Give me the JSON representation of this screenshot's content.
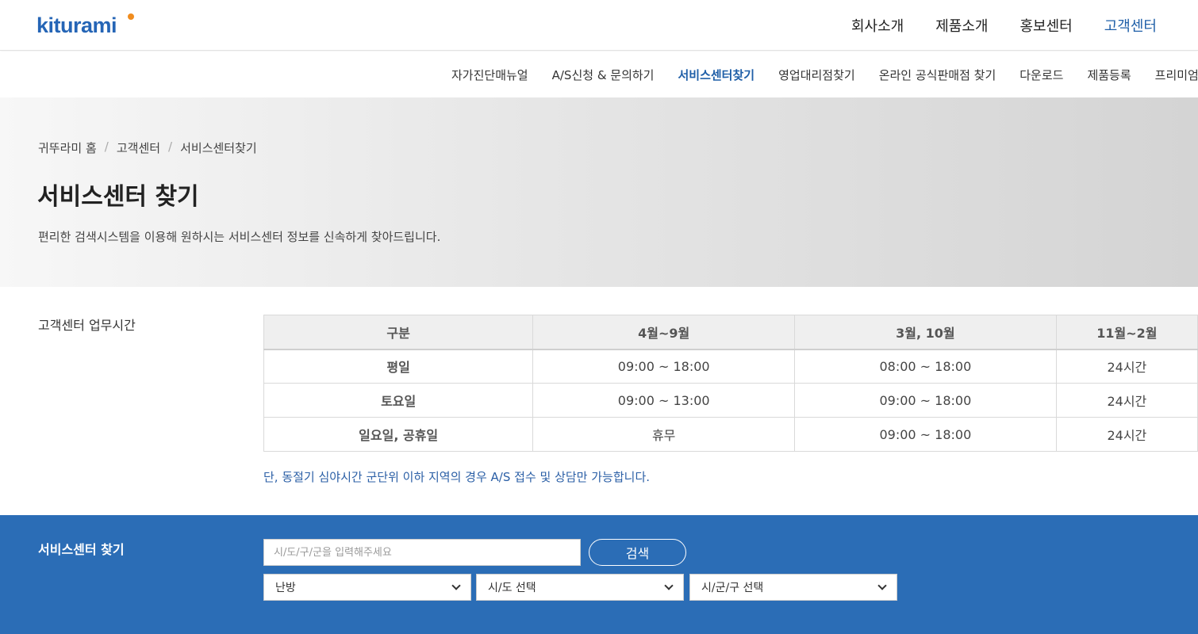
{
  "brand": {
    "logo_text": "kiturami"
  },
  "gnb": [
    {
      "label": "회사소개",
      "active": false
    },
    {
      "label": "제품소개",
      "active": false
    },
    {
      "label": "홍보센터",
      "active": false
    },
    {
      "label": "고객센터",
      "active": true
    }
  ],
  "snb": [
    {
      "label": "자가진단매뉴얼",
      "active": false
    },
    {
      "label": "A/S신청 & 문의하기",
      "active": false
    },
    {
      "label": "서비스센터찾기",
      "active": true
    },
    {
      "label": "영업대리점찾기",
      "active": false
    },
    {
      "label": "온라인 공식판매점 찾기",
      "active": false
    },
    {
      "label": "다운로드",
      "active": false
    },
    {
      "label": "제품등록",
      "active": false
    },
    {
      "label": "프리미엄",
      "active": false
    }
  ],
  "breadcrumb": [
    "귀뚜라미 홈",
    "고객센터",
    "서비스센터찾기"
  ],
  "hero": {
    "title": "서비스센터 찾기",
    "description": "편리한 검색시스템을 이용해 원하시는 서비스센터 정보를 신속하게 찾아드립니다."
  },
  "hours": {
    "label": "고객센터 업무시간",
    "headers": [
      "구분",
      "4월~9월",
      "3월, 10월",
      "11월~2월"
    ],
    "rows": [
      [
        "평일",
        "09:00 ~ 18:00",
        "08:00 ~ 18:00",
        "24시간"
      ],
      [
        "토요일",
        "09:00 ~ 13:00",
        "09:00 ~ 18:00",
        "24시간"
      ],
      [
        "일요일, 공휴일",
        "휴무",
        "09:00 ~ 18:00",
        "24시간"
      ]
    ],
    "notice": "단, 동절기 심야시간 군단위 이하 지역의 경우 A/S 접수 및 상담만 가능합니다."
  },
  "search": {
    "label": "서비스센터 찾기",
    "placeholder": "시/도/구/군을 입력해주세요",
    "value": "",
    "button": "검색",
    "selects": [
      "난방",
      "시/도 선택",
      "시/군/구 선택"
    ]
  },
  "colors": {
    "brand_blue": "#2565b6",
    "band_blue": "#2b6db6",
    "logo_orange": "#f08c1e"
  }
}
